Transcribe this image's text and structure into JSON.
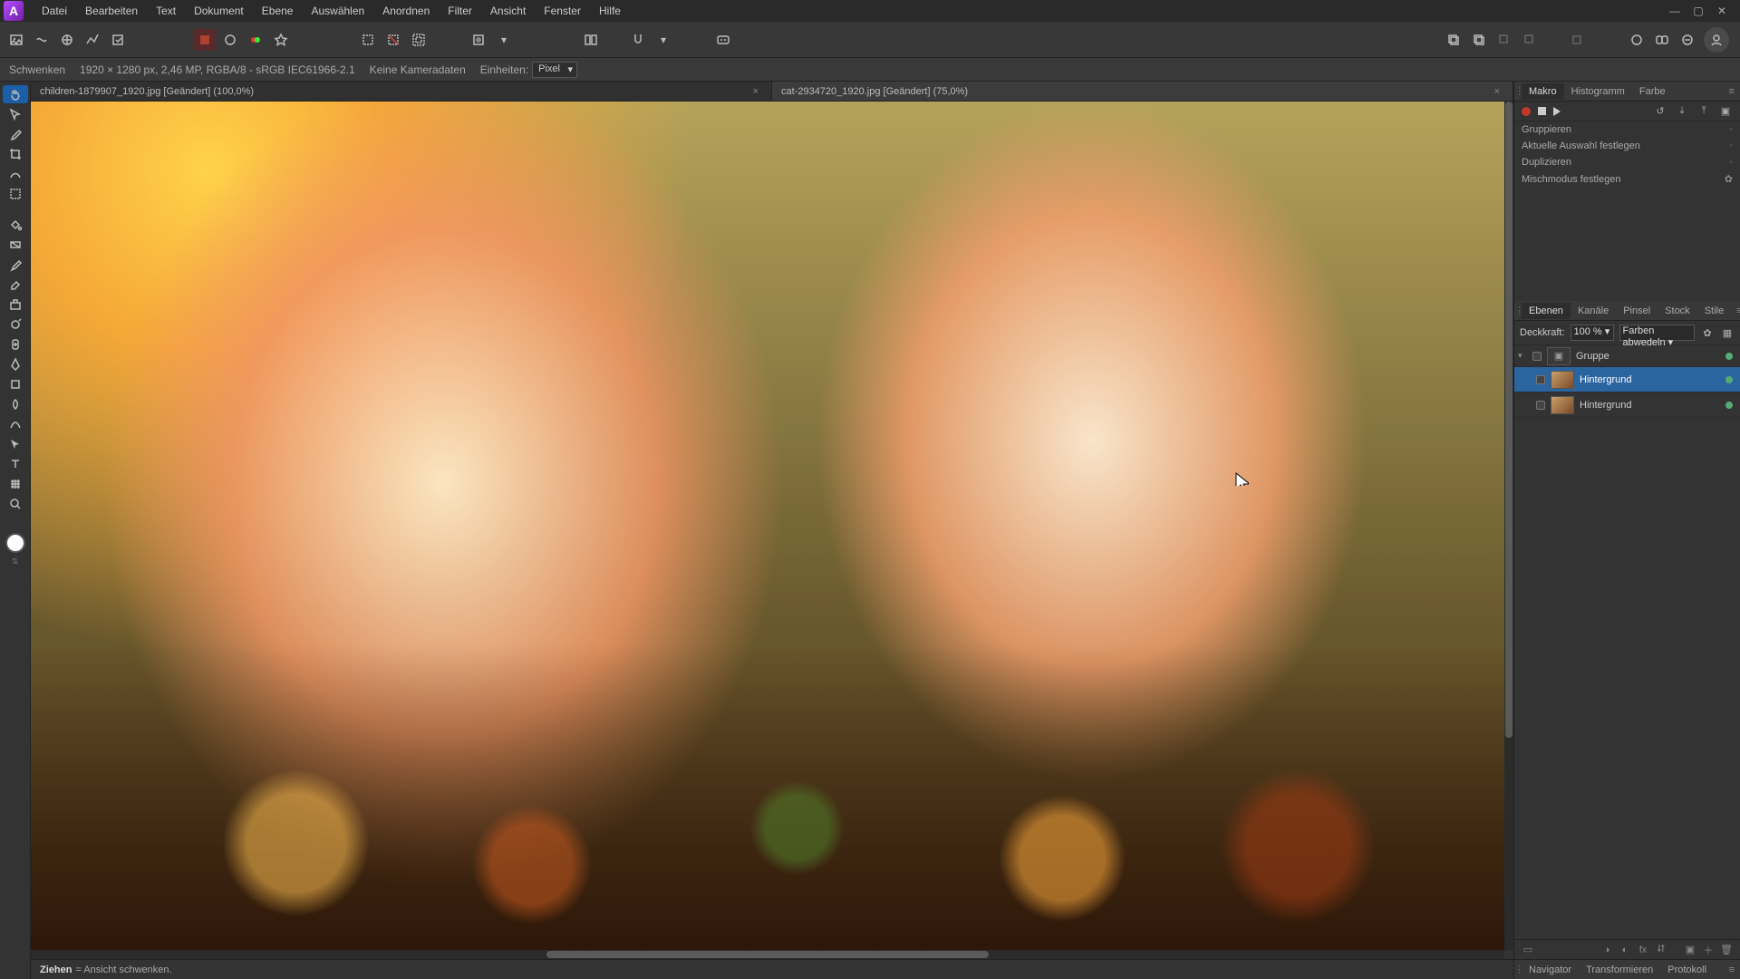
{
  "menu": {
    "items": [
      "Datei",
      "Bearbeiten",
      "Text",
      "Dokument",
      "Ebene",
      "Auswählen",
      "Anordnen",
      "Filter",
      "Ansicht",
      "Fenster",
      "Hilfe"
    ]
  },
  "context": {
    "tool_label": "Schwenken",
    "doc_info": "1920 × 1280 px, 2,46 MP, RGBA/8 - sRGB IEC61966-2.1",
    "camera": "Keine Kameradaten",
    "units_label": "Einheiten:",
    "units_value": "Pixel"
  },
  "tabs": [
    {
      "title": "children-1879907_1920.jpg [Geändert] (100,0%)",
      "active": true
    },
    {
      "title": "cat-2934720_1920.jpg [Geändert] (75,0%)",
      "active": false
    }
  ],
  "status": {
    "action": "Ziehen",
    "hint": " = Ansicht schwenken."
  },
  "right": {
    "top_tabs": [
      "Makro",
      "Histogramm",
      "Farbe"
    ],
    "macro_steps": [
      {
        "label": "Gruppieren",
        "gear": false
      },
      {
        "label": "Aktuelle Auswahl festlegen",
        "gear": false
      },
      {
        "label": "Duplizieren",
        "gear": false
      },
      {
        "label": "Mischmodus festlegen",
        "gear": true
      }
    ],
    "mid_tabs": [
      "Ebenen",
      "Kanäle",
      "Pinsel",
      "Stock",
      "Stile"
    ],
    "opacity_label": "Deckkraft:",
    "opacity_value": "100 %",
    "blend_value": "Farben abwedeln",
    "layers": [
      {
        "type": "group",
        "name": "Gruppe",
        "selected": false,
        "indent": 0
      },
      {
        "type": "pixel",
        "name": "Hintergrund",
        "selected": true,
        "indent": 1
      },
      {
        "type": "pixel",
        "name": "Hintergrund",
        "selected": false,
        "indent": 1
      }
    ],
    "bottom_tabs": [
      "Navigator",
      "Transformieren",
      "Protokoll"
    ]
  }
}
